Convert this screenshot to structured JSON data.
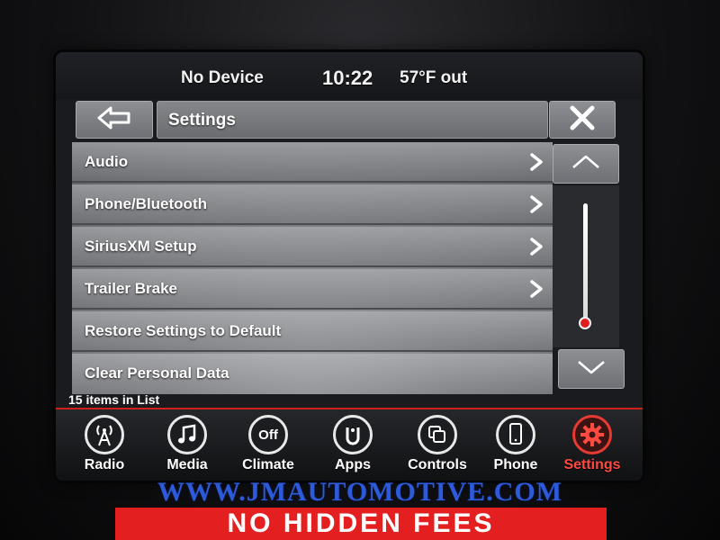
{
  "status_bar": {
    "device": "No Device",
    "time": "10:22",
    "temperature": "57°F out"
  },
  "header": {
    "title": "Settings",
    "back_icon": "back-arrow-icon",
    "close_icon": "close-icon"
  },
  "settings_list": {
    "items": [
      {
        "label": "Audio",
        "has_chevron": true
      },
      {
        "label": "Phone/Bluetooth",
        "has_chevron": true
      },
      {
        "label": "SiriusXM Setup",
        "has_chevron": true
      },
      {
        "label": "Trailer Brake",
        "has_chevron": true
      },
      {
        "label": "Restore Settings to Default",
        "has_chevron": false
      },
      {
        "label": "Clear Personal Data",
        "has_chevron": false
      }
    ],
    "count_text": "15 items in List"
  },
  "bottom_nav": {
    "items": [
      {
        "label": "Radio",
        "icon": "radio-tower-icon",
        "active": false
      },
      {
        "label": "Media",
        "icon": "music-note-icon",
        "active": false
      },
      {
        "label": "Climate",
        "icon": "climate-off-icon",
        "icon_text": "Off",
        "active": false
      },
      {
        "label": "Apps",
        "icon": "apps-icon",
        "active": false
      },
      {
        "label": "Controls",
        "icon": "controls-icon",
        "active": false
      },
      {
        "label": "Phone",
        "icon": "phone-icon",
        "active": false
      },
      {
        "label": "Settings",
        "icon": "gear-icon",
        "active": true
      }
    ]
  },
  "watermark": {
    "text": "WWW.JMAUTOMOTIVE.COM"
  },
  "banner": {
    "text": "NO HIDDEN FEES"
  },
  "colors": {
    "accent_red": "#e02020",
    "watermark_blue": "#2d5ad8",
    "banner_red": "#e41f1f"
  }
}
